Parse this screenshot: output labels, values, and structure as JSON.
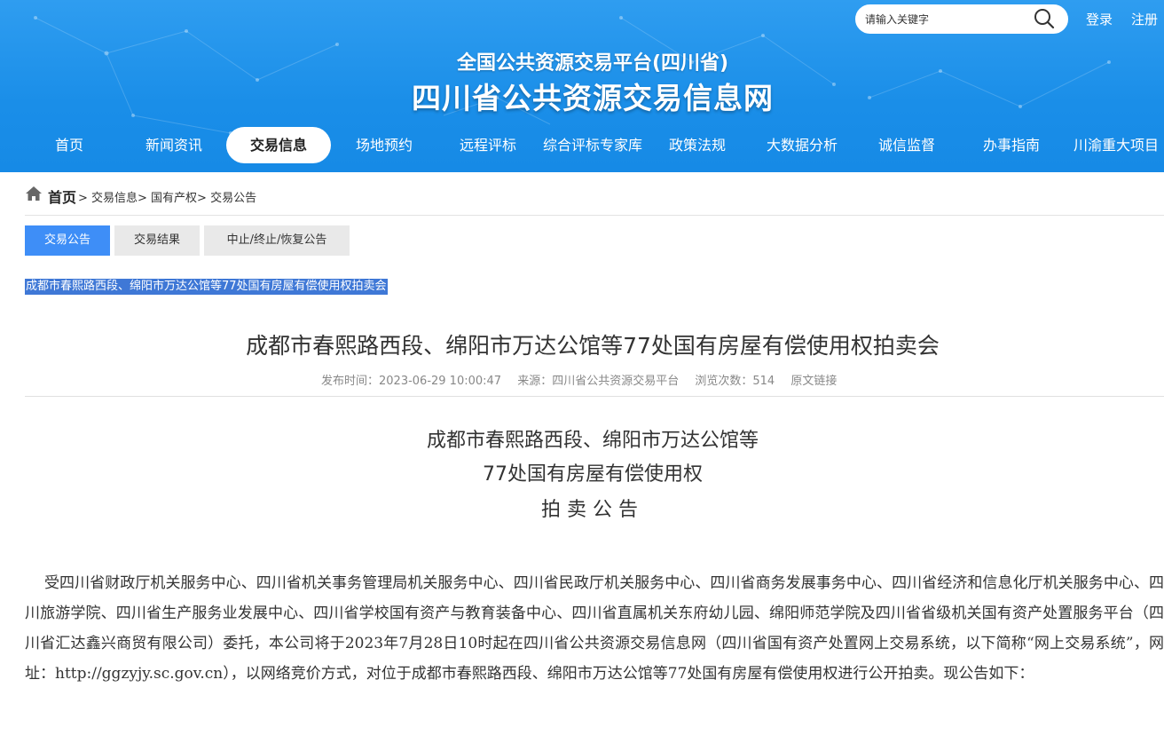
{
  "header": {
    "search": {
      "placeholder": "请输入关键字"
    },
    "login": "登录",
    "register": "注册",
    "subtitle": "全国公共资源交易平台(四川省)",
    "title": "四川省公共资源交易信息网",
    "colors": {
      "header_bg": "#1a8ee8",
      "active_nav_bg": "#ffffff"
    }
  },
  "nav": {
    "items": [
      {
        "label": "首页"
      },
      {
        "label": "新闻资讯"
      },
      {
        "label": "交易信息"
      },
      {
        "label": "场地预约"
      },
      {
        "label": "远程评标"
      },
      {
        "label": "综合评标专家库"
      },
      {
        "label": "政策法规"
      },
      {
        "label": "大数据分析"
      },
      {
        "label": "诚信监督"
      },
      {
        "label": "办事指南"
      },
      {
        "label": "川渝重大项目"
      }
    ],
    "active": "交易信息"
  },
  "breadcrumb": {
    "home": "首页",
    "path": "> 交易信息> 国有产权> 交易公告"
  },
  "tabs": {
    "items": [
      {
        "label": "交易公告"
      },
      {
        "label": "交易结果"
      },
      {
        "label": "中止/终止/恢复公告"
      }
    ],
    "active": "交易公告",
    "colors": {
      "active_bg": "#3e8ef7",
      "inactive_bg": "#e9e9e9"
    }
  },
  "article": {
    "selected_title": "成都市春熙路西段、绵阳市万达公馆等77处国有房屋有偿使用权拍卖会",
    "title": "成都市春熙路西段、绵阳市万达公馆等77处国有房屋有偿使用权拍卖会",
    "meta": {
      "publish_time": "发布时间：2023-06-29 10:00:47",
      "source": "来源：四川省公共资源交易平台",
      "views": "浏览次数：514",
      "original_link": "原文链接"
    },
    "heading_lines": [
      "成都市春熙路西段、绵阳市万达公馆等",
      "77处国有房屋有偿使用权",
      "拍卖公告"
    ],
    "body": "受四川省财政厅机关服务中心、四川省机关事务管理局机关服务中心、四川省民政厅机关服务中心、四川省商务发展事务中心、四川省经济和信息化厅机关服务中心、四川旅游学院、四川省生产服务业发展中心、四川省学校国有资产与教育装备中心、四川省直属机关东府幼儿园、绵阳师范学院及四川省省级机关国有资产处置服务平台（四川省汇达鑫兴商贸有限公司）委托，本公司将于2023年7月28日10时起在四川省公共资源交易信息网（四川省国有资产处置网上交易系统，以下简称“网上交易系统”，网址：http://ggzyjy.sc.gov.cn），以网络竞价方式，对位于成都市春熙路西段、绵阳市万达公馆等77处国有房屋有偿使用权进行公开拍卖。现公告如下："
  }
}
